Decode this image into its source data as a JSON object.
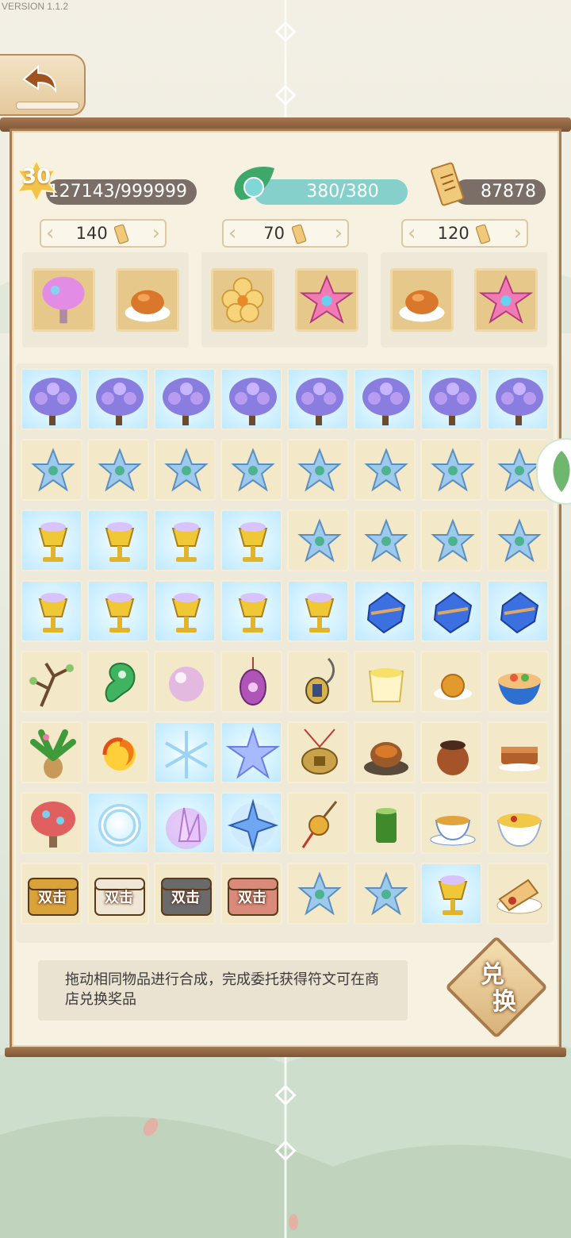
{
  "version": "VERSION 1.1.2",
  "header": {
    "level": "30",
    "exp": "127143/999999",
    "energy": "380/380",
    "scroll": "87878"
  },
  "orders": [
    {
      "price": "140",
      "items": [
        "pink-tree",
        "roast-chicken"
      ]
    },
    {
      "price": "70",
      "items": [
        "yellow-flower",
        "pink-flower"
      ]
    },
    {
      "price": "120",
      "items": [
        "roast-chicken",
        "pink-flower"
      ]
    }
  ],
  "grid": {
    "rows": [
      [
        "wisteria-tree",
        "wisteria-tree",
        "wisteria-tree",
        "wisteria-tree",
        "wisteria-tree",
        "wisteria-tree",
        "wisteria-tree",
        "wisteria-tree"
      ],
      [
        "ice-pendant",
        "ice-pendant",
        "ice-pendant",
        "ice-pendant",
        "ice-pendant",
        "ice-pendant",
        "ice-pendant",
        "ice-pendant"
      ],
      [
        "golden-goblet",
        "golden-goblet",
        "golden-goblet",
        "golden-goblet",
        "ice-pendant",
        "ice-pendant",
        "ice-pendant",
        "ice-pendant"
      ],
      [
        "golden-goblet",
        "golden-goblet",
        "golden-goblet",
        "golden-goblet",
        "golden-goblet",
        "blue-crystal",
        "blue-crystal",
        "blue-crystal"
      ],
      [
        "branch",
        "jade-magatama",
        "pearl",
        "egg-pendant",
        "bell-pendant",
        "custard",
        "mooncake",
        "noodle-bowl"
      ],
      [
        "palm-tree",
        "fire-swirl",
        "snowflake",
        "ice-flower",
        "jade-amulet",
        "soup-bowl",
        "clay-pot",
        "braised-meat"
      ],
      [
        "coral-tree",
        "water-ring",
        "crystal-cluster",
        "star-crystal",
        "gold-pendant",
        "bamboo-tube",
        "tea-cup",
        "congee"
      ],
      [
        "chest-gold",
        "chest-white",
        "chest-iron",
        "chest-red",
        "ice-pendant",
        "ice-pendant",
        "golden-goblet",
        "spring-roll"
      ]
    ],
    "chest_label": "双击"
  },
  "hint": "拖动相同物品进行合成，完成委托获得符文可在商店兑换奖品",
  "exchange_button": {
    "line1": "兑",
    "line2": "换"
  },
  "colors": {
    "panel": "#f7f1e1",
    "frame": "#a67c52",
    "energy": "#86d0cc",
    "bar": "#7b6e66"
  }
}
